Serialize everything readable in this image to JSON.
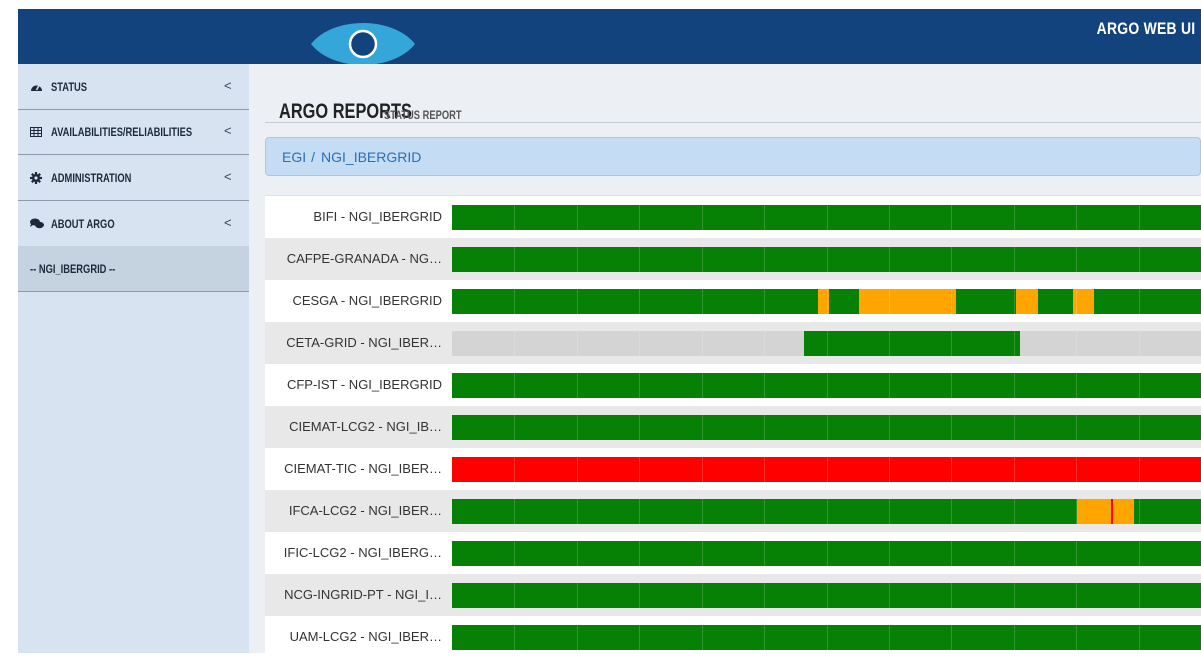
{
  "header": {
    "brand": "ARGO WEB UI"
  },
  "sidebar": {
    "items": [
      {
        "label": "STATUS",
        "icon": "dashboard-icon",
        "chevron": "<"
      },
      {
        "label": "AVAILABILITIES/RELIABILITIES",
        "icon": "table-icon",
        "chevron": "<"
      },
      {
        "label": "ADMINISTRATION",
        "icon": "gear-icon",
        "chevron": "<"
      },
      {
        "label": "ABOUT ARGO",
        "icon": "comments-icon",
        "chevron": "<"
      }
    ],
    "active_group": "-- NGI_IBERGRID --"
  },
  "page": {
    "title": "ARGO REPORTS",
    "subtitle": "STATUS REPORT"
  },
  "breadcrumb": {
    "root": "EGI",
    "separator": "/",
    "current": "NGI_IBERGRID"
  },
  "colors": {
    "ok": "#068106",
    "warning": "#ffa500",
    "critical": "#ff0000",
    "unknown": "#d4d4d4",
    "header": "#13437c",
    "sidebar": "#d7e3f0"
  },
  "timeline": {
    "rows": [
      {
        "name": "BIFI - NGI_IBERGRID",
        "segments": [
          {
            "status": "ok",
            "start": 0,
            "end": 1
          }
        ]
      },
      {
        "name": "CAFPE-GRANADA - NG…",
        "segments": [
          {
            "status": "ok",
            "start": 0,
            "end": 1
          }
        ]
      },
      {
        "name": "CESGA - NGI_IBERGRID",
        "segments": [
          {
            "status": "ok",
            "start": 0,
            "end": 0.489
          },
          {
            "status": "warning",
            "start": 0.489,
            "end": 0.503
          },
          {
            "status": "ok",
            "start": 0.503,
            "end": 0.543
          },
          {
            "status": "warning",
            "start": 0.543,
            "end": 0.673
          },
          {
            "status": "ok",
            "start": 0.673,
            "end": 0.753
          },
          {
            "status": "warning",
            "start": 0.753,
            "end": 0.782
          },
          {
            "status": "ok",
            "start": 0.782,
            "end": 0.829
          },
          {
            "status": "warning",
            "start": 0.829,
            "end": 0.857
          },
          {
            "status": "ok",
            "start": 0.857,
            "end": 1
          }
        ]
      },
      {
        "name": "CETA-GRID - NGI_IBER…",
        "segments": [
          {
            "status": "unknown",
            "start": 0,
            "end": 0.47
          },
          {
            "status": "ok",
            "start": 0.47,
            "end": 0.759
          },
          {
            "status": "unknown",
            "start": 0.759,
            "end": 1
          }
        ]
      },
      {
        "name": "CFP-IST - NGI_IBERGRID",
        "segments": [
          {
            "status": "ok",
            "start": 0,
            "end": 1
          }
        ]
      },
      {
        "name": "CIEMAT-LCG2 - NGI_IB…",
        "segments": [
          {
            "status": "ok",
            "start": 0,
            "end": 1
          }
        ]
      },
      {
        "name": "CIEMAT-TIC - NGI_IBER…",
        "segments": [
          {
            "status": "critical",
            "start": 0,
            "end": 1
          }
        ]
      },
      {
        "name": "IFCA-LCG2 - NGI_IBER…",
        "segments": [
          {
            "status": "ok",
            "start": 0,
            "end": 0.834
          },
          {
            "status": "warning",
            "start": 0.834,
            "end": 0.88
          },
          {
            "status": "critical",
            "start": 0.88,
            "end": 0.883
          },
          {
            "status": "warning",
            "start": 0.883,
            "end": 0.91
          },
          {
            "status": "ok",
            "start": 0.91,
            "end": 1
          }
        ]
      },
      {
        "name": "IFIC-LCG2 - NGI_IBERG…",
        "segments": [
          {
            "status": "ok",
            "start": 0,
            "end": 1
          }
        ]
      },
      {
        "name": "NCG-INGRID-PT - NGI_I…",
        "segments": [
          {
            "status": "ok",
            "start": 0,
            "end": 1
          }
        ]
      },
      {
        "name": "UAM-LCG2 - NGI_IBER…",
        "segments": [
          {
            "status": "ok",
            "start": 0,
            "end": 1
          }
        ]
      }
    ]
  }
}
